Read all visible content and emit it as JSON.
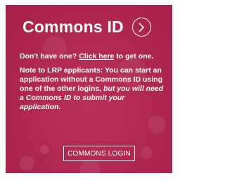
{
  "card": {
    "title": "Commons ID",
    "arrow_icon": "chevron-right-circle-icon",
    "no_account_prefix": "Don't have one?",
    "no_account_link": "Click here",
    "no_account_suffix": "to get one.",
    "note_plain": "Note to LRP applicants: You can start an application without a Commons ID using one of the other logins,",
    "note_italic": "but you will need a Commons ID to submit your application.",
    "login_button_label": "COMMONS LOGIN"
  },
  "colors": {
    "card_background": "#b5234f",
    "text": "#ffffff"
  }
}
